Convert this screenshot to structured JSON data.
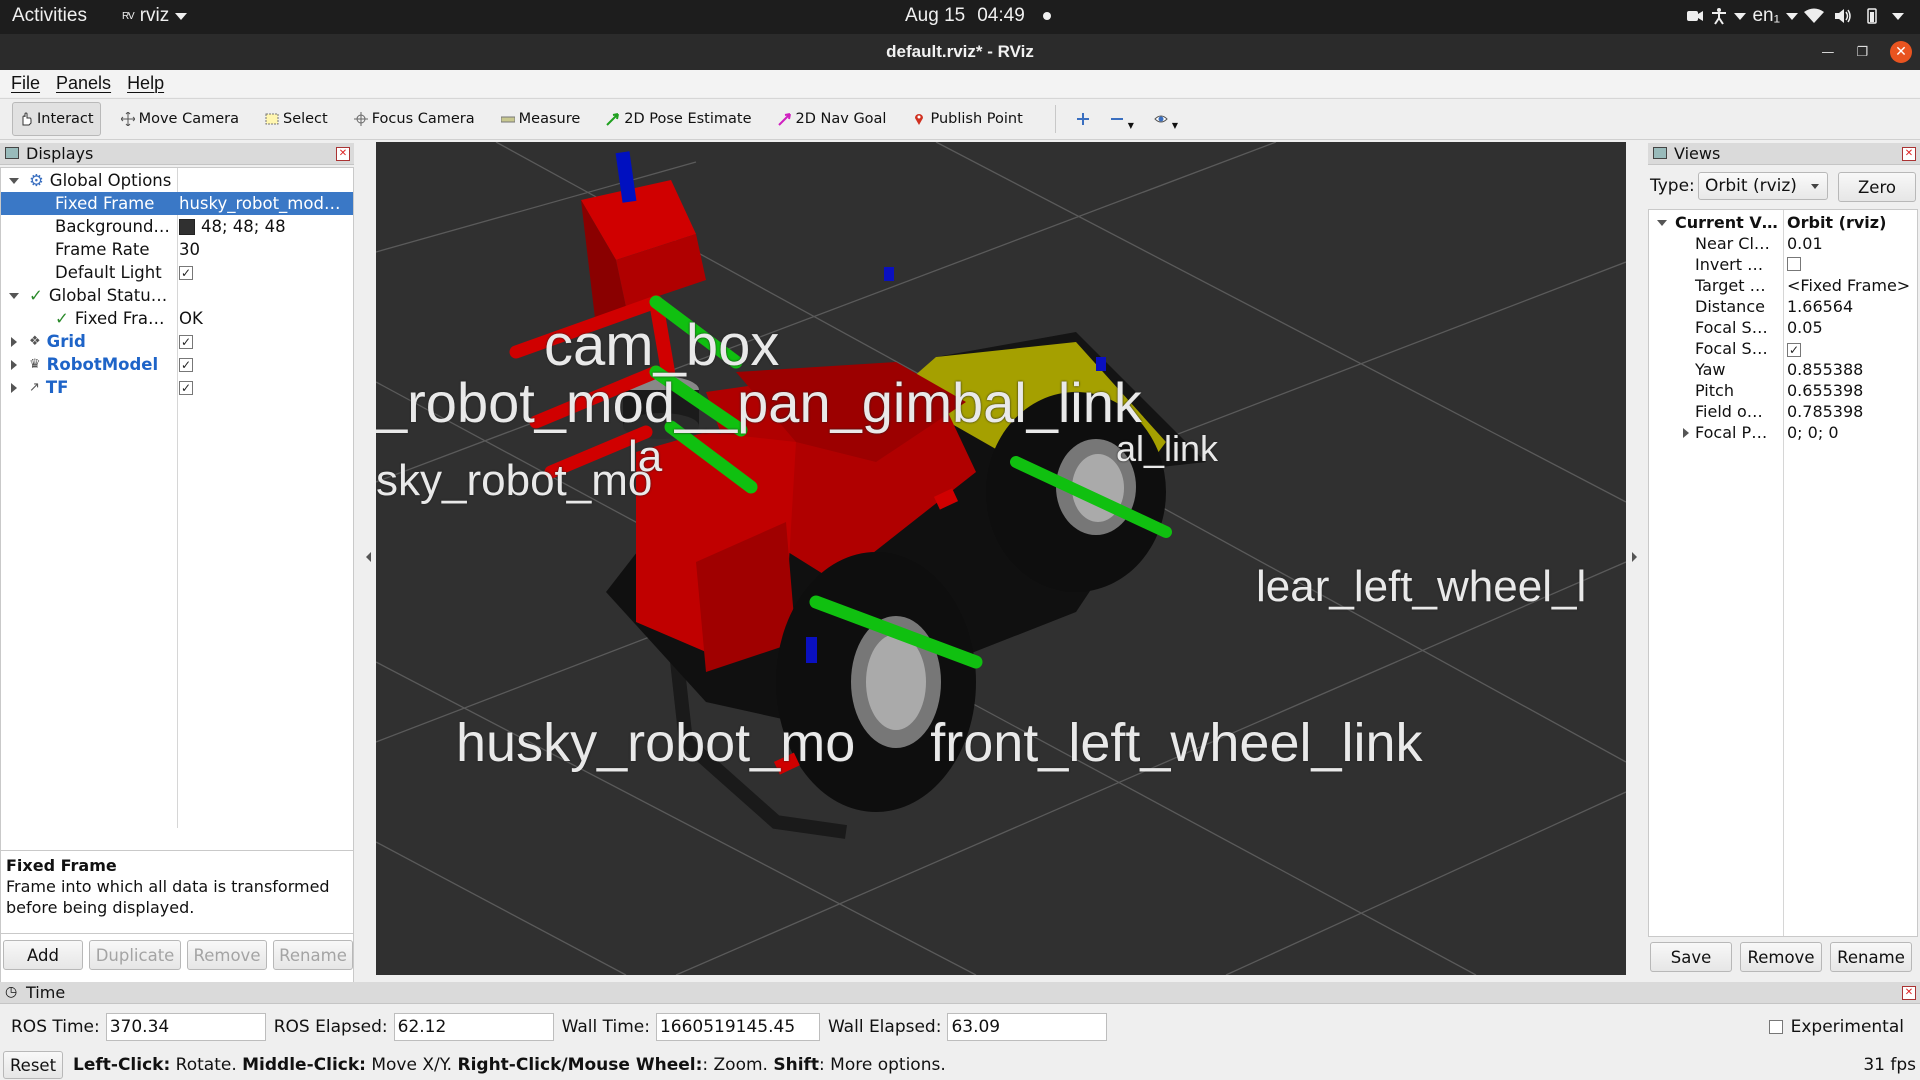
{
  "topbar": {
    "activities": "Activities",
    "app_icon": "rviz-logo",
    "app_name": "rviz",
    "date": "Aug 15",
    "time": "04:49",
    "input_method": "en₁"
  },
  "window": {
    "title": "default.rviz* - RViz"
  },
  "menubar": {
    "file": "File",
    "panels": "Panels",
    "help": "Help"
  },
  "toolbar": {
    "interact": "Interact",
    "move_camera": "Move Camera",
    "select": "Select",
    "focus_camera": "Focus Camera",
    "measure": "Measure",
    "pose_estimate": "2D Pose Estimate",
    "nav_goal": "2D Nav Goal",
    "publish_point": "Publish Point"
  },
  "displays": {
    "title": "Displays",
    "global_options": "Global Options",
    "fixed_frame_label": "Fixed Frame",
    "fixed_frame_value": "husky_robot_mod…",
    "background_label": "Background…",
    "background_value": "48; 48; 48",
    "frame_rate_label": "Frame Rate",
    "frame_rate_value": "30",
    "default_light_label": "Default Light",
    "global_status": "Global Statu…",
    "fixed_frame_status_label": "Fixed Fra…",
    "fixed_frame_status_value": "OK",
    "grid": "Grid",
    "robot_model": "RobotModel",
    "tf": "TF",
    "check_mark": "✓",
    "desc_title": "Fixed Frame",
    "desc_text": "Frame into which all data is transformed before being displayed.",
    "add": "Add",
    "duplicate": "Duplicate",
    "remove": "Remove",
    "rename": "Rename"
  },
  "scene_labels": {
    "cam_box": "cam_box",
    "pan_gimbal": "_robot_mod__pan_gimbal_link",
    "husky_left": "sky_robot_mo",
    "la": "la",
    "al_link": "al_link",
    "rear_left_wheel": "lear_left_wheel_l",
    "front_left_wheel": "husky_robot_mo     front_left_wheel_link"
  },
  "views": {
    "title": "Views",
    "type_label": "Type:",
    "type_value": "Orbit (rviz)",
    "zero": "Zero",
    "current_view_label": "Current V…",
    "current_view_value": "Orbit (rviz)",
    "near_clip_label": "Near Cl…",
    "near_clip_value": "0.01",
    "invert_label": "Invert …",
    "target_label": "Target …",
    "target_value": "<Fixed Frame>",
    "distance_label": "Distance",
    "distance_value": "1.66564",
    "focal_size_label": "Focal S…",
    "focal_size_value": "0.05",
    "focal_shape_label": "Focal S…",
    "yaw_label": "Yaw",
    "yaw_value": "0.855388",
    "pitch_label": "Pitch",
    "pitch_value": "0.655398",
    "fov_label": "Field o…",
    "fov_value": "0.785398",
    "focal_point_label": "Focal P…",
    "focal_point_value": "0; 0; 0",
    "save": "Save",
    "remove": "Remove",
    "rename": "Rename"
  },
  "time": {
    "title": "Time",
    "ros_time_label": "ROS Time:",
    "ros_time_value": "370.34",
    "ros_elapsed_label": "ROS Elapsed:",
    "ros_elapsed_value": "62.12",
    "wall_time_label": "Wall Time:",
    "wall_time_value": "1660519145.45",
    "wall_elapsed_label": "Wall Elapsed:",
    "wall_elapsed_value": "63.09",
    "experimental": "Experimental"
  },
  "status": {
    "reset": "Reset",
    "left_click": "Left-Click:",
    "rotate": " Rotate. ",
    "middle_click": "Middle-Click:",
    "move_xy": " Move X/Y. ",
    "right_click": "Right-Click/Mouse Wheel:",
    "zoom": ": Zoom. ",
    "shift": "Shift",
    "more": ": More options.",
    "fps": "31 fps"
  },
  "colors": {
    "accent_selection": "#3a78c6",
    "view_background": "#303030",
    "close_button": "#e95420",
    "robot_red": "#c00000",
    "robot_yellow": "#b5b000"
  }
}
